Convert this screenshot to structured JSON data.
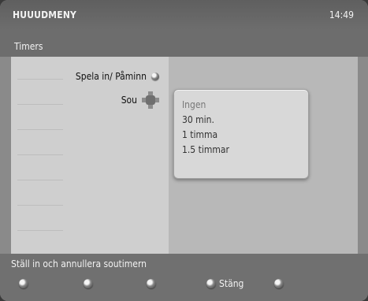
{
  "header": {
    "title": "HUUUDMENY",
    "time": "14:49"
  },
  "section": {
    "title": "Timers"
  },
  "left_menu": {
    "items": [
      {
        "label": "Spela in/ Påminn",
        "icon": "circle-button-icon"
      },
      {
        "label": "Sou",
        "icon": "directional-pad-icon"
      }
    ]
  },
  "options": {
    "items": [
      {
        "label": "Ingen",
        "state": "highlighted"
      },
      {
        "label": "30 min.",
        "state": "normal"
      },
      {
        "label": "1 timma",
        "state": "normal"
      },
      {
        "label": "1.5 timmar",
        "state": "normal"
      }
    ]
  },
  "footer": {
    "help_text": "Ställ in och annullera soutimern",
    "buttons": [
      {
        "label": "",
        "icon": "circle-button-icon"
      },
      {
        "label": "",
        "icon": "circle-button-icon"
      },
      {
        "label": "",
        "icon": "circle-button-icon"
      },
      {
        "label": "Stäng",
        "icon": "circle-button-icon"
      },
      {
        "label": "",
        "icon": "circle-button-icon"
      }
    ]
  }
}
